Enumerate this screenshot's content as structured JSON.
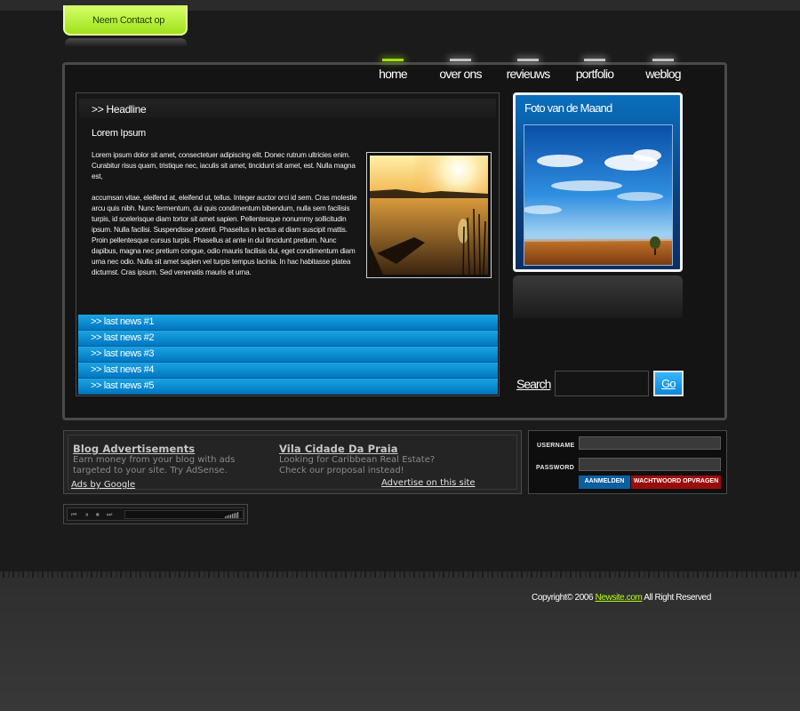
{
  "contact_tab": {
    "label": "Neem Contact op"
  },
  "nav": {
    "items": [
      {
        "label": "home",
        "active": true
      },
      {
        "label": "over ons",
        "active": false
      },
      {
        "label": "revieuws",
        "active": false
      },
      {
        "label": "portfolio",
        "active": false
      },
      {
        "label": "weblog",
        "active": false
      }
    ]
  },
  "content": {
    "headline": ">> Headline",
    "subheading": "Lorem Ipsum",
    "paragraphs": [
      "Lorem ipsum dolor sit amet, consectetuer adipiscing elit. Donec rutrum ultricies enim. Curabitur risus quam, tristique nec, iaculis sit amet, tincidunt sit amet, est. Nulla magna est,",
      "accumsan vitae, eleifend at, eleifend ut, tellus. Integer auctor orci id sem. Cras molestie arcu quis nibh. Nunc fermentum, dui quis condimentum bibendum, nulla sem facilisis turpis, id scelerisque diam tortor sit amet sapien. Pellentesque nonummy sollicitudin ipsum. Nulla facilisi. Suspendisse potenti. Phasellus in lectus at diam suscipit mattis. Proin pellentesque cursus turpis. Phasellus at ante in dui tincidunt pretium. Nunc dapibus, magna nec pretium congue, odio mauris facilisis dui, eget condimentum diam urna nec odio. Nulla sit amet sapien vel turpis tempus lacinia. In hac habitasse platea dictumst. Cras ipsum. Sed venenatis mauris et urna."
    ],
    "news": [
      ">> last news #1",
      ">> last news #2",
      ">> last news #3",
      ">> last news #4",
      ">> last news #5"
    ]
  },
  "foto": {
    "title": "Foto van de Maand"
  },
  "search": {
    "label": "Search",
    "value": "",
    "button": "Go"
  },
  "ads": {
    "items": [
      {
        "title": "Blog Advertisements",
        "text1": "Earn money from your blog with ads",
        "text2": "targeted to your site. Try AdSense."
      },
      {
        "title": "Vila Cidade Da Praia",
        "text1": "Looking for Caribbean Real Estate?",
        "text2": "Check our proposal instead!"
      }
    ],
    "ads_by": "Ads by Google",
    "advertise": "Advertise on this site"
  },
  "login": {
    "username_label": "USERNAME",
    "password_label": "PASSWORD",
    "username_value": "",
    "password_value": "",
    "login_button": "AANMELDEN",
    "forgot_button": "WACHTWOORD OPVRAGEN"
  },
  "player": {
    "icons": [
      "previous-icon",
      "pause-icon",
      "stop-icon",
      "next-icon",
      "volume-icon"
    ]
  },
  "footer": {
    "prefix": "Copyright© 2006 ",
    "site": "Newsite.com",
    "suffix": " All Right Reserved"
  },
  "colors": {
    "accent_green": "#9ee012",
    "news_blue": "#0a8fd6",
    "foto_blue": "#0a6fbd",
    "forgot_red": "#9a0d0d"
  }
}
